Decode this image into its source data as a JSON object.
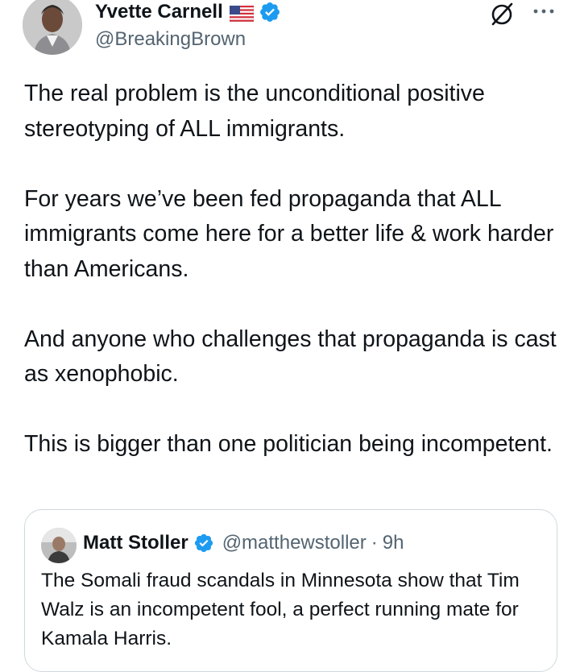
{
  "author": {
    "name": "Yvette Carnell",
    "handle": "@BreakingBrown",
    "flag_icon": "us-flag-icon",
    "verified_icon": "verified-badge-icon"
  },
  "header_icons": [
    "grok-icon",
    "more-options-icon"
  ],
  "tweet": {
    "paragraphs": [
      "The real problem is the unconditional positive stereotyping of ALL immigrants.",
      "For years we’ve been fed propaganda that ALL immigrants come here for a better life & work harder than Americans.",
      "And anyone who challenges that propaganda is cast as xenophobic.",
      "This is bigger than one politician being incompetent."
    ]
  },
  "quoted_tweet": {
    "name": "Matt Stoller",
    "handle": "@matthewstoller",
    "separator": "·",
    "time": "9h",
    "text": "The Somali fraud scandals in Minnesota show that Tim Walz is an incompetent fool, a perfect running mate for Kamala Harris."
  },
  "colors": {
    "text": "#0f1419",
    "secondary": "#536471",
    "verified_blue": "#1d9bf0",
    "border": "#cfd9de"
  }
}
